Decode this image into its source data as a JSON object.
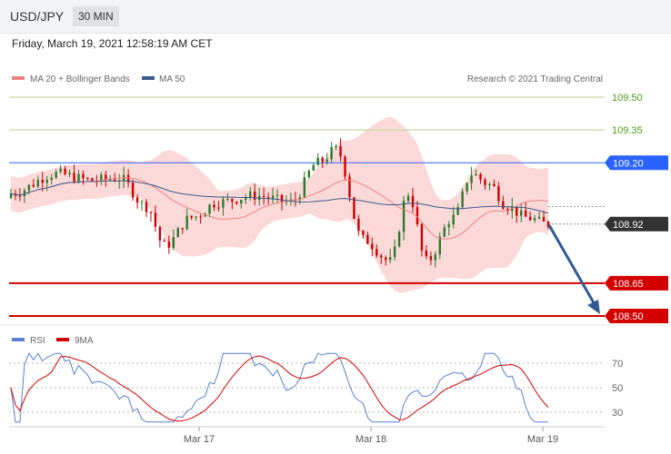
{
  "header": {
    "pair": "USD/JPY",
    "timeframe": "30 MIN"
  },
  "timestamp": "Friday, March 19, 2021 12:58:19 AM CET",
  "legend": {
    "ma20": "MA 20 + Bollinger Bands",
    "ma50": "MA 50",
    "research": "Research © 2021 Trading Central"
  },
  "rsi_legend": {
    "rsi": "RSI",
    "ma9": "9MA"
  },
  "colors": {
    "ma20": "#f08080",
    "ma50": "#3a5a8c",
    "bands": "#fbd9d9",
    "up": "#2a7a2a",
    "down": "#cc0000",
    "resistance_line": "#c8d8a0",
    "pivot": "#2962ff",
    "support": "#d40000",
    "arrow": "#2f5a94"
  },
  "chart_data": [
    {
      "type": "line",
      "title": "",
      "ylim": [
        108.4,
        109.6
      ],
      "x_ticks": [
        "Mar 17",
        "Mar 18",
        "Mar 19"
      ],
      "levels": [
        {
          "value": 109.5,
          "label": "109.50",
          "kind": "resistance"
        },
        {
          "value": 109.35,
          "label": "109.35",
          "kind": "resistance"
        },
        {
          "value": 109.2,
          "label": "109.20",
          "kind": "pivot"
        },
        {
          "value": 108.92,
          "label": "108.92",
          "kind": "last"
        },
        {
          "value": 108.65,
          "label": "108.65",
          "kind": "support"
        },
        {
          "value": 108.5,
          "label": "108.50",
          "kind": "support"
        }
      ],
      "series": [
        {
          "name": "MA 20 + Bollinger Bands"
        },
        {
          "name": "MA 50"
        }
      ]
    },
    {
      "type": "line",
      "ylim": [
        20,
        80
      ],
      "y_ticks": [
        70,
        50,
        30
      ],
      "series": [
        {
          "name": "RSI"
        },
        {
          "name": "9MA"
        }
      ]
    }
  ]
}
